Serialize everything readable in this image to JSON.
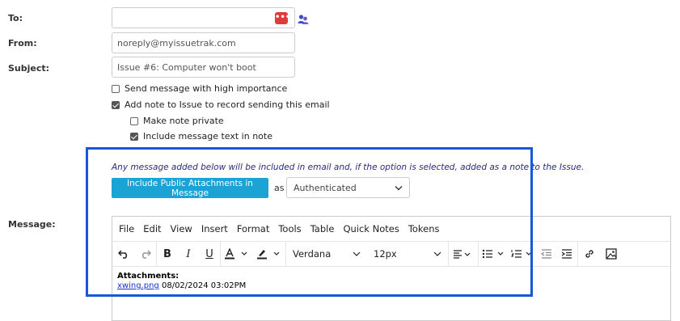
{
  "form": {
    "to_label": "To:",
    "to_value": "",
    "from_label": "From:",
    "from_value": "noreply@myissuetrak.com",
    "subject_label": "Subject:",
    "subject_value": "Issue #6: Computer won't boot",
    "message_label": "Message:"
  },
  "options": [
    {
      "label": "Send message with high importance",
      "checked": false
    },
    {
      "label": "Add note to Issue to record sending this email",
      "checked": true
    },
    {
      "label": "Make note private",
      "checked": false
    },
    {
      "label": "Include message text in note",
      "checked": true
    }
  ],
  "message_note": "Any message added below will be included in email and, if the option is selected, added as a note to the Issue.",
  "attach_button_label": "Include Public Attachments in Message",
  "as_label": "as",
  "visibility_select": "Authenticated",
  "editor": {
    "menu": [
      "File",
      "Edit",
      "View",
      "Insert",
      "Format",
      "Tools",
      "Table",
      "Quick Notes",
      "Tokens"
    ],
    "font_family": "Verdana",
    "font_size": "12px",
    "attachments_heading": "Attachments:",
    "attachment_file": "xwing.png",
    "attachment_date": "08/02/2024 03:02PM"
  },
  "colors": {
    "highlight": "#1a56db",
    "button": "#1aa3d4",
    "password_icon": "#e03a3a"
  }
}
